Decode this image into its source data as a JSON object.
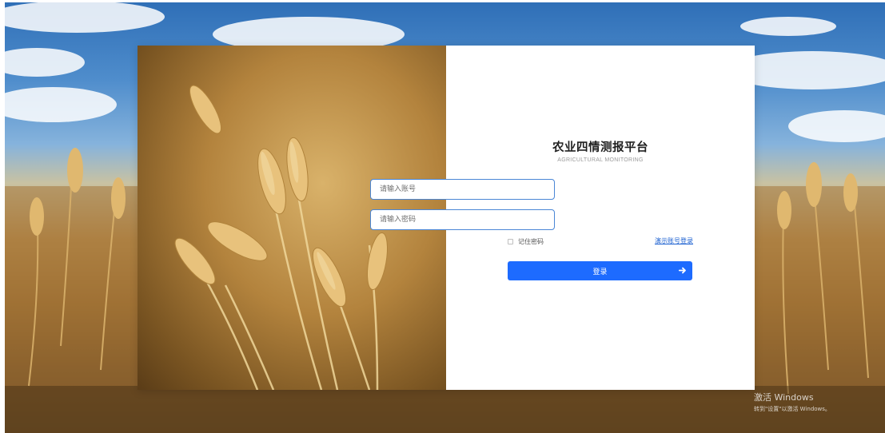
{
  "platform": {
    "title": "农业四情测报平台",
    "subtitle": "AGRICULTURAL MONITORING"
  },
  "form": {
    "account_placeholder": "请输入账号",
    "password_placeholder": "请输入密码",
    "remember_label": "记住密码",
    "remember_checked": false,
    "demo_link": "演示账号登录",
    "login_label": "登录",
    "login_icon": "arrow-right-icon"
  },
  "watermark": {
    "line1": "激活 Windows",
    "line2": "转到\"设置\"以激活 Windows。"
  },
  "colors": {
    "primary": "#1d6bff",
    "field_border": "#4a86d6",
    "link": "#1a5fd0"
  }
}
